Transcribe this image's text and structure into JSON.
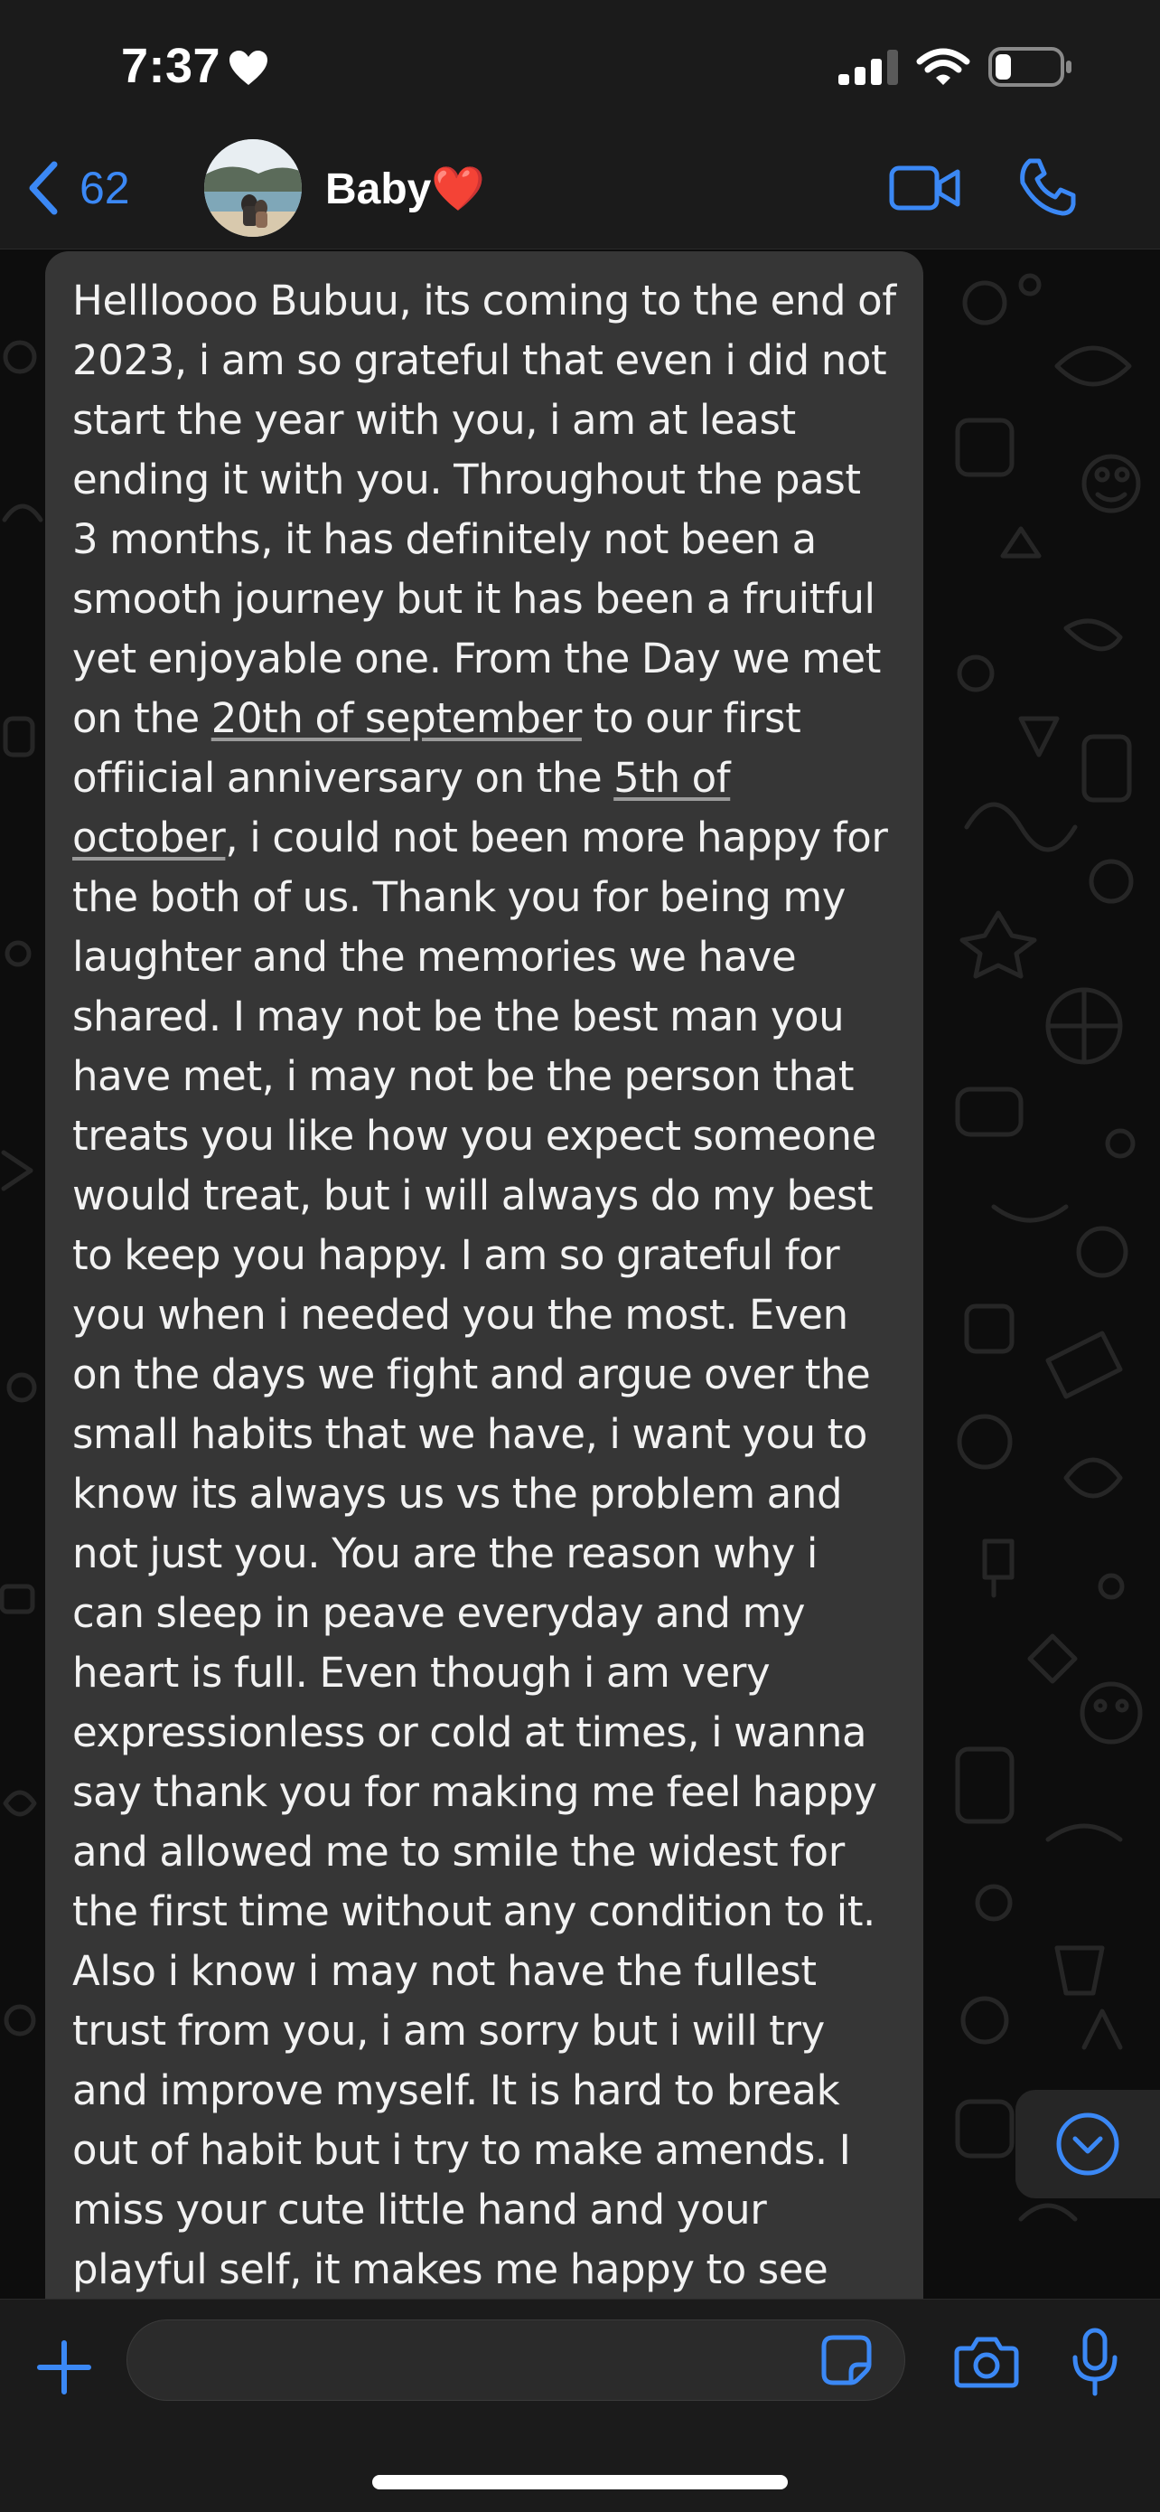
{
  "status_bar": {
    "time": "7:37",
    "battery_level": 0.25
  },
  "header": {
    "back_count": "62",
    "contact_name": "Baby❤️"
  },
  "message": {
    "intro": "Hellloooo Bubuu,  its coming to the end of 2023, i am so grateful that even i did not start the year with you, i am at least ending it with you. Throughout the past 3 months, it has definitely not been a smooth journey but it has been a fruitful yet enjoyable one. From the Day we met on the ",
    "date_1": "20th of september",
    "middle": " to our first offiicial anniversary on the ",
    "date_2": "5th of october",
    "rest": ", i could not been more happy for the both of us. Thank you for being my laughter and the memories we have shared. I may not be the best man you have met, i may not be the person that treats you like how you expect someone would treat, but i will always do my best to keep you happy. I am so grateful for you when i needed you the most. Even on the days we fight and argue over the small habits that we have, i want you to know its always us vs the problem and not just you. You are the reason why i can sleep in peave everyday and my heart is full. Even though i am very expressionless or cold at times, i wanna say thank you for making me feel happy and allowed me to smile the widest for the first time without any condition to it. Also i know i may not have the fullest trust from you, i am sorry but i will try and improve myself. It is hard to break out of habit but i try to make amends. I miss your cute little hand and your playful self, it makes me happy to see"
  },
  "input": {
    "placeholder": "",
    "value": ""
  },
  "colors": {
    "accent": "#3b88f5",
    "bubble": "#363636",
    "bar": "#1b1b1b"
  }
}
